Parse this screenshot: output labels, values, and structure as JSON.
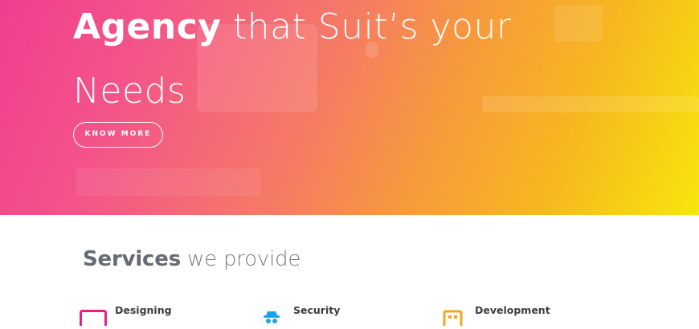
{
  "hero": {
    "heading_bold": "Agency",
    "heading_line1_rest": " that Suit’s your",
    "heading_line2": "Needs",
    "button_label": "KNOW MORE"
  },
  "services": {
    "title_bold": "Services",
    "title_rest": " we provide",
    "items": [
      {
        "label": "Designing",
        "icon": "monitor-icon",
        "color": "#e91e8c"
      },
      {
        "label": "Security",
        "icon": "spy-icon",
        "color": "#1aa3e8"
      },
      {
        "label": "Development",
        "icon": "grid-icon",
        "color": "#f5a623"
      }
    ]
  }
}
